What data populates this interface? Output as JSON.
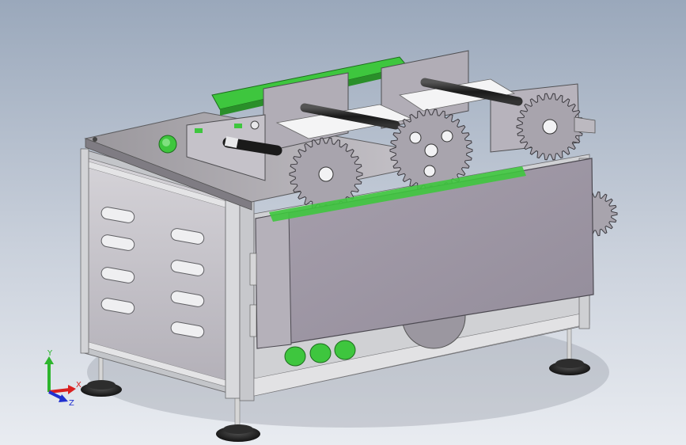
{
  "viewport": {
    "background_top": "#9aa8bb",
    "background_bottom": "#e9ecf1"
  },
  "model": {
    "highlight_color": "#3ec63e",
    "panel_color": "#b8b5bc",
    "frame_color": "#c6c8cc",
    "foot_color": "#1e1e1e"
  },
  "triad": {
    "y_label": "Y",
    "x_label": "X",
    "z_label": "Z",
    "y_color": "#2db52d",
    "x_color": "#d92020",
    "z_color": "#2030d0"
  }
}
